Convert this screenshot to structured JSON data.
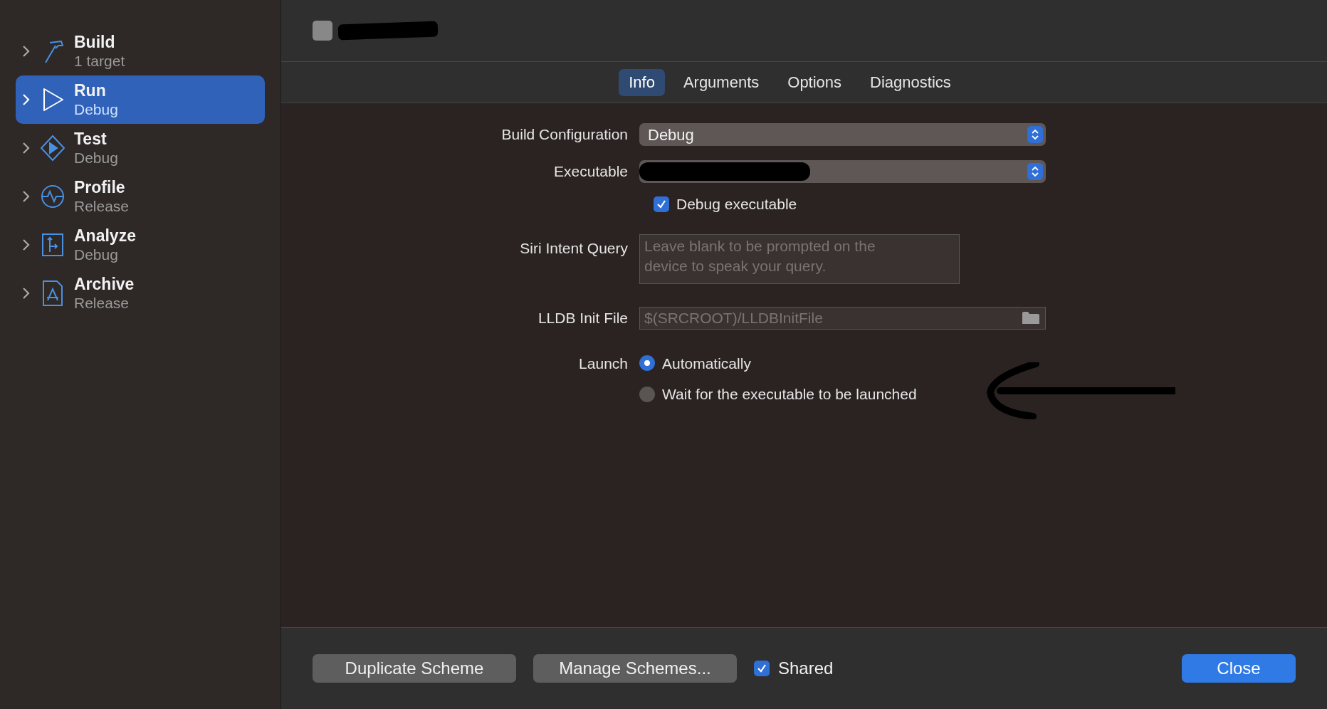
{
  "sidebar": {
    "items": [
      {
        "kind": "build",
        "title": "Build",
        "subtitle": "1 target",
        "selected": false
      },
      {
        "kind": "run",
        "title": "Run",
        "subtitle": "Debug",
        "selected": true
      },
      {
        "kind": "test",
        "title": "Test",
        "subtitle": "Debug",
        "selected": false
      },
      {
        "kind": "profile",
        "title": "Profile",
        "subtitle": "Release",
        "selected": false
      },
      {
        "kind": "analyze",
        "title": "Analyze",
        "subtitle": "Debug",
        "selected": false
      },
      {
        "kind": "archive",
        "title": "Archive",
        "subtitle": "Release",
        "selected": false
      }
    ]
  },
  "tabs": [
    {
      "label": "Info",
      "selected": true
    },
    {
      "label": "Arguments",
      "selected": false
    },
    {
      "label": "Options",
      "selected": false
    },
    {
      "label": "Diagnostics",
      "selected": false
    }
  ],
  "form": {
    "build_configuration": {
      "label": "Build Configuration",
      "value": "Debug"
    },
    "executable": {
      "label": "Executable"
    },
    "debug_executable": {
      "label": "Debug executable",
      "checked": true
    },
    "siri_intent_query": {
      "label": "Siri Intent Query",
      "placeholder": "Leave blank to be prompted on the device to speak your query."
    },
    "lldb_init_file": {
      "label": "LLDB Init File",
      "placeholder": "$(SRCROOT)/LLDBInitFile"
    },
    "launch": {
      "label": "Launch",
      "options": [
        {
          "label": "Automatically",
          "selected": true
        },
        {
          "label": "Wait for the executable to be launched",
          "selected": false
        }
      ]
    }
  },
  "footer": {
    "duplicate": "Duplicate Scheme",
    "manage": "Manage Schemes...",
    "shared": {
      "label": "Shared",
      "checked": true
    },
    "close": "Close"
  }
}
